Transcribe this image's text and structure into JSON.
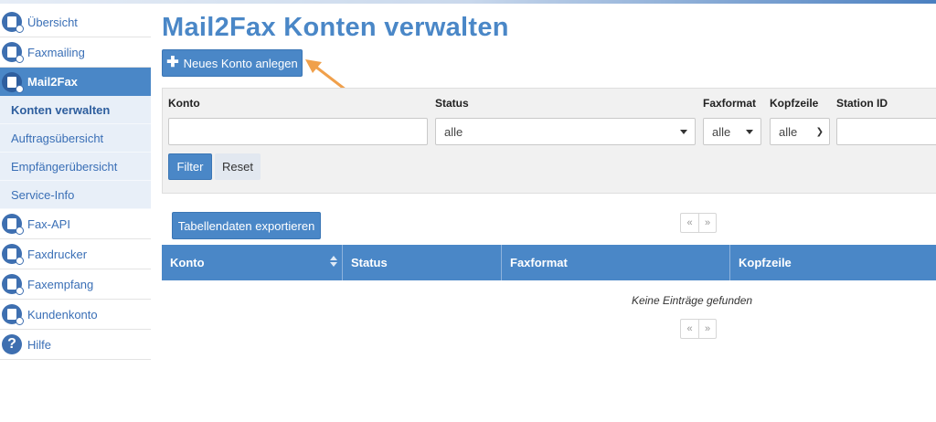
{
  "sidebar": {
    "items": [
      {
        "label": "Übersicht",
        "icon": "overview-icon"
      },
      {
        "label": "Faxmailing",
        "icon": "faxmailing-icon"
      },
      {
        "label": "Mail2Fax",
        "icon": "mail2fax-icon",
        "active": true
      },
      {
        "label": "Fax-API",
        "icon": "fax-api-icon"
      },
      {
        "label": "Faxdrucker",
        "icon": "fax-printer-icon"
      },
      {
        "label": "Faxempfang",
        "icon": "fax-receive-icon"
      },
      {
        "label": "Kundenkonto",
        "icon": "customer-account-icon"
      },
      {
        "label": "Hilfe",
        "icon": "help-icon"
      }
    ],
    "subitems": [
      {
        "label": "Konten verwalten",
        "current": true
      },
      {
        "label": "Auftragsübersicht"
      },
      {
        "label": "Empfängerübersicht"
      },
      {
        "label": "Service-Info"
      }
    ]
  },
  "main": {
    "title": "Mail2Fax Konten verwalten",
    "new_account_button": "Neues Konto anlegen",
    "filter": {
      "konto_label": "Konto",
      "konto_value": "",
      "status_label": "Status",
      "status_value": "alle",
      "faxformat_label": "Faxformat",
      "faxformat_value": "alle",
      "kopfzeile_label": "Kopfzeile",
      "kopfzeile_value": "alle",
      "station_label": "Station ID",
      "station_value": "",
      "filter_button": "Filter",
      "reset_button": "Reset"
    },
    "export_button": "Tabellendaten exportieren",
    "pager": {
      "prev": "«",
      "next": "»"
    },
    "table": {
      "columns": [
        "Konto",
        "Status",
        "Faxformat",
        "Kopfzeile"
      ],
      "empty_text": "Keine Einträge gefunden"
    }
  },
  "colors": {
    "accent": "#4a87c7",
    "annotation_arrow": "#f0a04b"
  }
}
